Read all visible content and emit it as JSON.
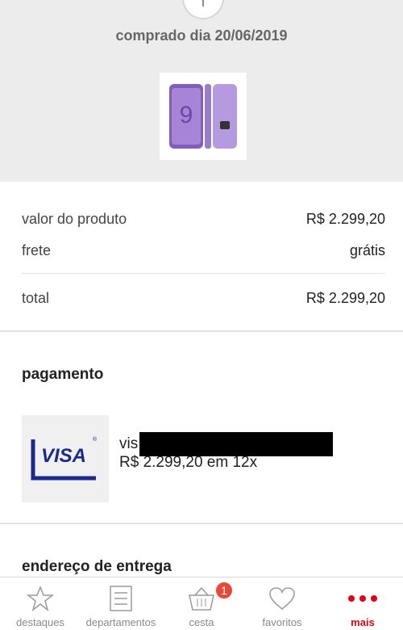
{
  "order": {
    "purchase_date": "comprado dia 20/06/2019",
    "product_image_icon": "smartphone-image"
  },
  "summary": {
    "product_value_label": "valor do produto",
    "product_value": "R$ 2.299,20",
    "shipping_label": "frete",
    "shipping_value": "grátis",
    "total_label": "total",
    "total_value": "R$ 2.299,20"
  },
  "payment": {
    "title": "pagamento",
    "card_brand": "VISA",
    "card_name_prefix": "vis",
    "installments": "R$ 2.299,20 em 12x"
  },
  "address": {
    "title": "endereço de entrega"
  },
  "tabbar": {
    "items": [
      {
        "label": "destaques",
        "icon": "star-icon"
      },
      {
        "label": "departamentos",
        "icon": "list-icon"
      },
      {
        "label": "cesta",
        "icon": "basket-icon",
        "badge": "1"
      },
      {
        "label": "favoritos",
        "icon": "heart-icon"
      },
      {
        "label": "mais",
        "icon": "more-icon"
      }
    ],
    "active_color": "#e60014",
    "badge_color": "#e84a3a"
  }
}
